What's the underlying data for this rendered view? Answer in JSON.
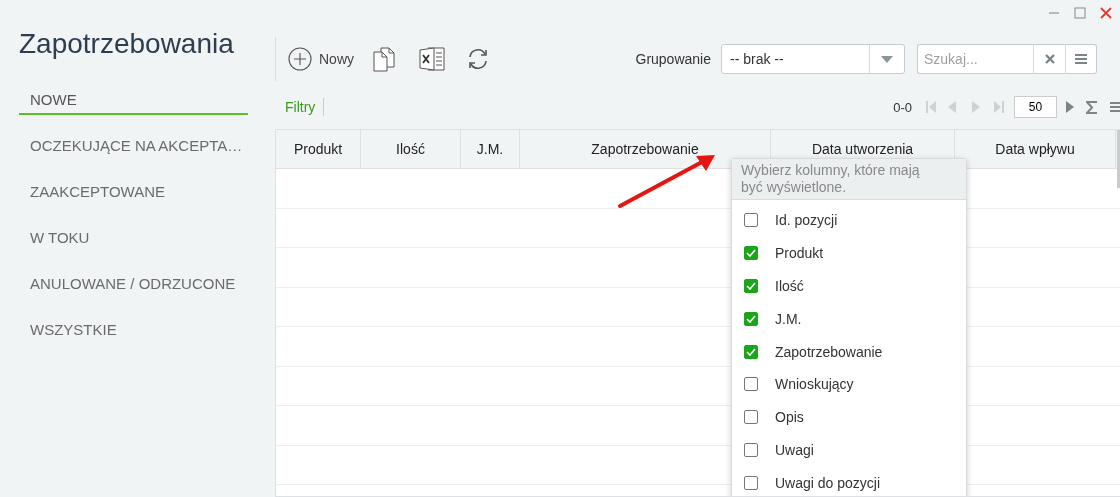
{
  "title": "Zapotrzebowania",
  "sidebar": {
    "items": [
      {
        "label": "NOWE",
        "selected": true
      },
      {
        "label": "OCZEKUJĄCE NA AKCEPTA…",
        "selected": false
      },
      {
        "label": "ZAAKCEPTOWANE",
        "selected": false
      },
      {
        "label": "W TOKU",
        "selected": false
      },
      {
        "label": "ANULOWANE / ODRZUCONE",
        "selected": false
      },
      {
        "label": "WSZYSTKIE",
        "selected": false
      }
    ]
  },
  "toolbar": {
    "new_button": "Nowy",
    "grouping": {
      "label": "Grupowanie",
      "value": "-- brak --"
    },
    "search": {
      "placeholder": "Szukaj..."
    }
  },
  "filter_link": "Filtry",
  "pager": {
    "range": "0-0",
    "page_size": "50"
  },
  "table": {
    "columns": [
      "Produkt",
      "Ilość",
      "J.M.",
      "Zapotrzebowanie",
      "Data utworzenia",
      "Data wpływu"
    ]
  },
  "column_picker": {
    "hint": "Wybierz kolumny, które mają być wyświetlone.",
    "items": [
      {
        "label": "Id. pozycji",
        "checked": false
      },
      {
        "label": "Produkt",
        "checked": true
      },
      {
        "label": "Ilość",
        "checked": true
      },
      {
        "label": "J.M.",
        "checked": true
      },
      {
        "label": "Zapotrzebowanie",
        "checked": true
      },
      {
        "label": "Wnioskujący",
        "checked": false
      },
      {
        "label": "Opis",
        "checked": false
      },
      {
        "label": "Uwagi",
        "checked": false
      },
      {
        "label": "Uwagi do pozycji",
        "checked": false
      }
    ]
  }
}
